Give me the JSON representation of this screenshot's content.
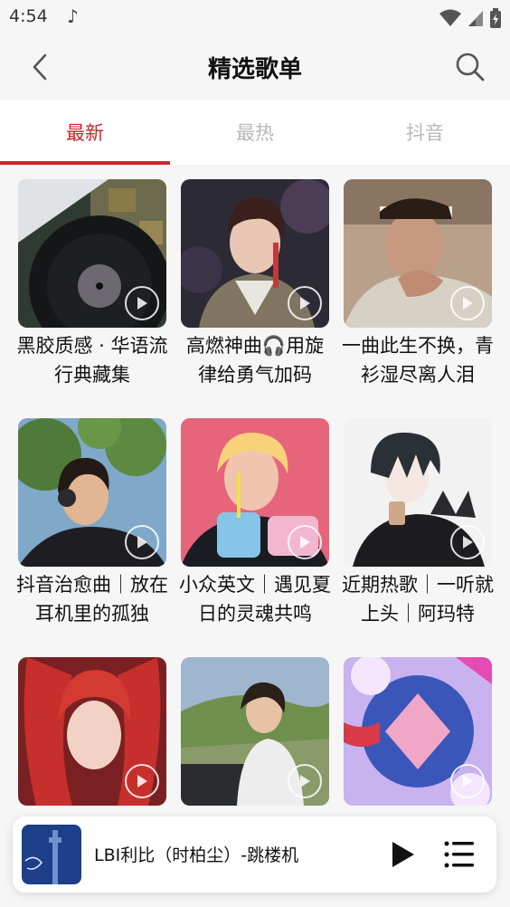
{
  "status": {
    "time": "4:54"
  },
  "header": {
    "title": "精选歌单"
  },
  "tabs": [
    {
      "label": "最新"
    },
    {
      "label": "最热"
    },
    {
      "label": "抖音"
    }
  ],
  "playlists": [
    {
      "title": "黑胶质感 · 华语流行典藏集"
    },
    {
      "title": "高燃神曲🎧用旋律给勇气加码"
    },
    {
      "title": "一曲此生不换，青衫湿尽离人泪"
    },
    {
      "title": "抖音治愈曲｜放在耳机里的孤独"
    },
    {
      "title": "小众英文｜遇见夏日的灵魂共鸣"
    },
    {
      "title": "近期热歌｜一听就上头｜阿玛特"
    },
    {
      "title": ""
    },
    {
      "title": ""
    },
    {
      "title": ""
    }
  ],
  "player": {
    "song": "LBI利比（时柏尘）-跳楼机"
  },
  "colors": {
    "accent": "#d2232a",
    "tab_inactive": "#b8b8b8"
  }
}
